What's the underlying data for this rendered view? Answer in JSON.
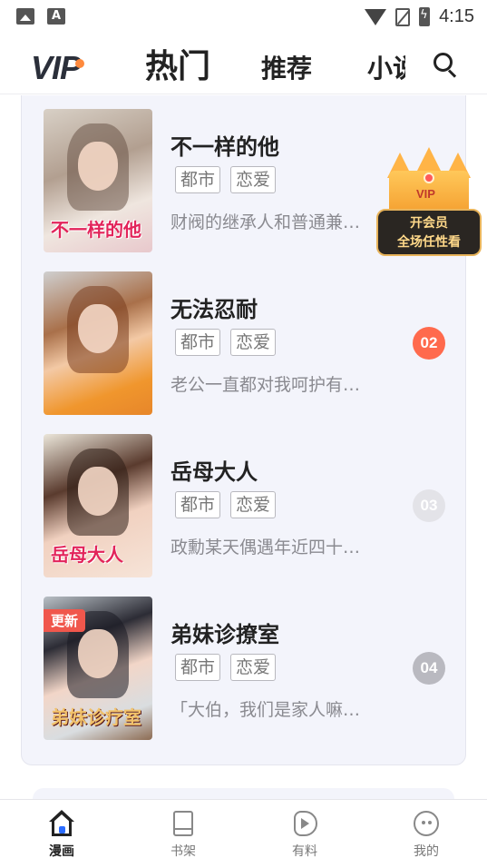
{
  "status_bar": {
    "time": "4:15",
    "left_icons": [
      "image-icon",
      "a-icon"
    ],
    "a_glyph": "A"
  },
  "header": {
    "logo": "VIP",
    "tabs": [
      {
        "label": "热门",
        "active": true
      },
      {
        "label": "推荐",
        "active": false
      },
      {
        "label": "小说",
        "active": false
      }
    ],
    "search_icon": "search-icon"
  },
  "comics": [
    {
      "title": "不一样的他",
      "cover_text": "不一样的他",
      "tags": [
        "都市",
        "恋爱"
      ],
      "description": "财阀的继承人和普通兼职打工的女大学生",
      "rank": "",
      "is_new": false
    },
    {
      "title": "无法忍耐",
      "cover_text": "",
      "tags": [
        "都市",
        "恋爱"
      ],
      "description": "老公一直都对我呵护有加…",
      "rank": "02",
      "is_new": false
    },
    {
      "title": "岳母大人",
      "cover_text": "岳母大人",
      "tags": [
        "都市",
        "恋爱"
      ],
      "description": "政勳某天偶遇年近四十的女人…",
      "rank": "03",
      "is_new": false
    },
    {
      "title": "弟妹诊撩室",
      "cover_text": "弟妹诊疗室",
      "tags": [
        "都市",
        "恋爱"
      ],
      "description": "「大伯，我们是家人嘛」…",
      "rank": "04",
      "is_new": true,
      "new_label": "更新"
    }
  ],
  "side_peek": {
    "new_label": "更新"
  },
  "vip_promo": {
    "crown_text": "VIP",
    "line1": "开会员",
    "line2": "全场任性看"
  },
  "bottom_nav": [
    {
      "label": "漫画",
      "icon": "home-icon",
      "active": true
    },
    {
      "label": "书架",
      "icon": "bookshelf-icon",
      "active": false
    },
    {
      "label": "有料",
      "icon": "play-icon",
      "active": false
    },
    {
      "label": "我的",
      "icon": "profile-icon",
      "active": false
    }
  ],
  "colors": {
    "accent_orange": "#ff6a4d",
    "new_badge": "#f0574c",
    "card_bg": "#f3f4fb",
    "home_door": "#2b6cff"
  }
}
